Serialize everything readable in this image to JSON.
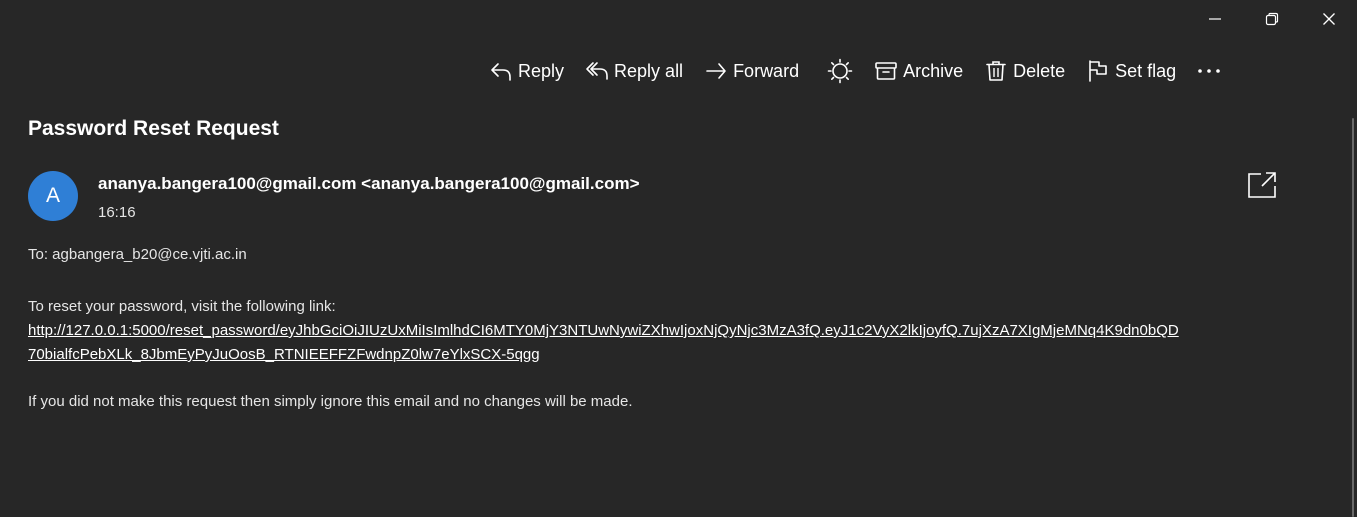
{
  "window_controls": {
    "minimize_icon": "minimize-icon",
    "restore_icon": "restore-icon",
    "close_icon": "close-icon"
  },
  "toolbar": {
    "reply_label": "Reply",
    "reply_all_label": "Reply all",
    "forward_label": "Forward",
    "theme_icon": "sun-icon",
    "archive_label": "Archive",
    "delete_label": "Delete",
    "set_flag_label": "Set flag",
    "more_icon": "more-icon"
  },
  "message": {
    "subject": "Password Reset Request",
    "avatar_initial": "A",
    "sender": "ananya.bangera100@gmail.com <ananya.bangera100@gmail.com>",
    "time": "16:16",
    "to": "To: agbangera_b20@ce.vjti.ac.in",
    "intro": "To reset your password, visit the following link:",
    "link_line1": "http://127.0.0.1:5000/reset_password/eyJhbGciOiJIUzUxMiIsImlhdCI6MTY0MjY3NTUwNywiZXhwIjoxNjQyNjc3MzA3fQ.eyJ1c2VyX2lkIjoyfQ.7ujXzA7XIgMjeMNq4K9dn0bQD",
    "link_line2": "70bialfcPebXLk_8JbmEyPyJuOosB_RTNIEEFFZFwdnpZ0lw7eYlxSCX-5qgg",
    "closing": "If you did not make this request then simply ignore this email and no changes will be made."
  },
  "colors": {
    "background": "#272727",
    "avatar": "#2f7fd6",
    "text": "#ffffff"
  }
}
